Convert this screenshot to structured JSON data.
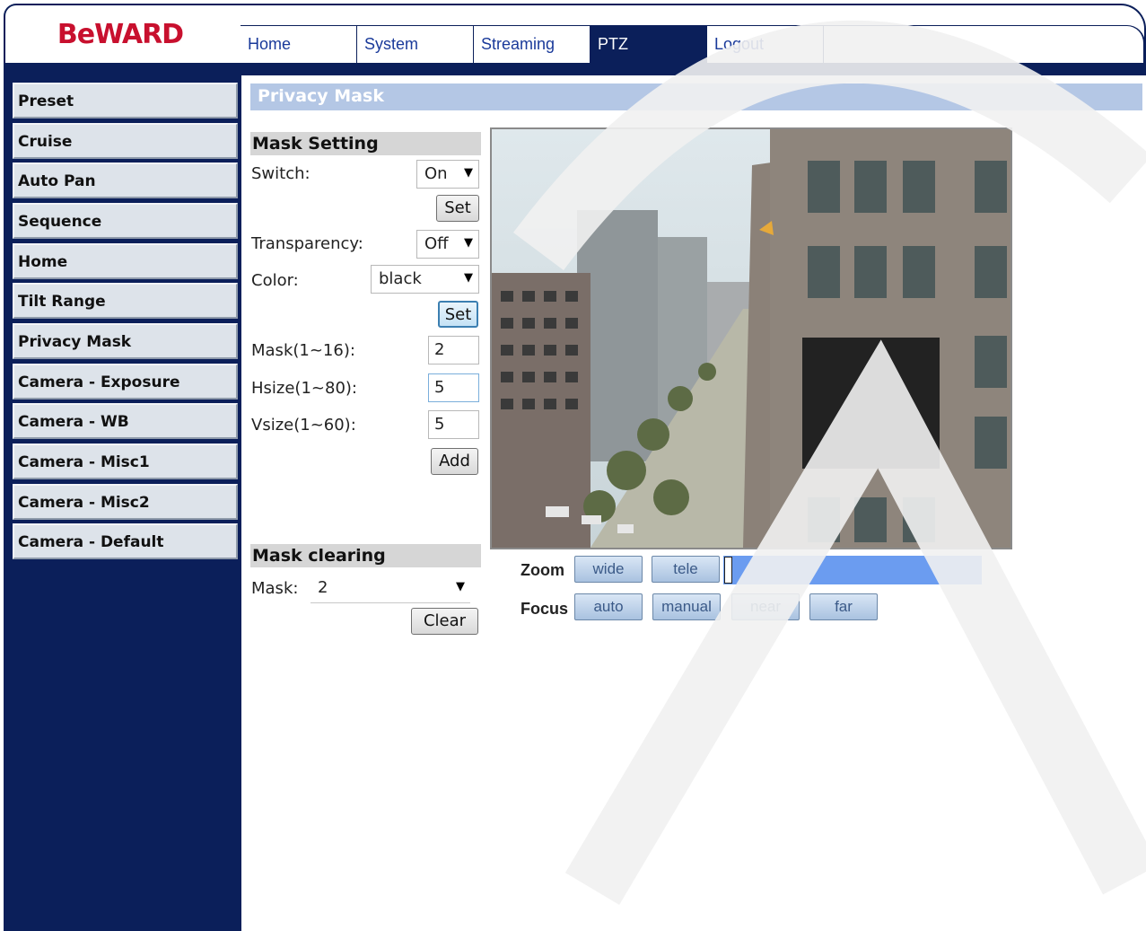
{
  "brand": {
    "logo_text": "BeWARD",
    "color": "#c8102e"
  },
  "nav": {
    "tabs": [
      {
        "label": "Home",
        "active": false
      },
      {
        "label": "System",
        "active": false
      },
      {
        "label": "Streaming",
        "active": false
      },
      {
        "label": "PTZ",
        "active": true
      },
      {
        "label": "Logout",
        "active": false
      }
    ]
  },
  "sidebar": {
    "items": [
      {
        "label": "Preset"
      },
      {
        "label": "Cruise"
      },
      {
        "label": "Auto Pan"
      },
      {
        "label": "Sequence"
      },
      {
        "label": "Home"
      },
      {
        "label": "Tilt Range"
      },
      {
        "label": "Privacy Mask"
      },
      {
        "label": "Camera - Exposure"
      },
      {
        "label": "Camera - WB"
      },
      {
        "label": "Camera - Misc1"
      },
      {
        "label": "Camera - Misc2"
      },
      {
        "label": "Camera - Default"
      }
    ]
  },
  "page": {
    "title": "Privacy Mask"
  },
  "mask_setting": {
    "heading": "Mask Setting",
    "switch_label": "Switch:",
    "switch_value": "On",
    "set_label": "Set",
    "transparency_label": "Transparency:",
    "transparency_value": "Off",
    "color_label": "Color:",
    "color_value": "black",
    "set2_label": "Set",
    "mask_label": "Mask(1~16):",
    "mask_value": "2",
    "hsize_label": "Hsize(1~80):",
    "hsize_value": "5",
    "vsize_label": "Vsize(1~60):",
    "vsize_value": "5",
    "add_label": "Add"
  },
  "mask_clearing": {
    "heading": "Mask clearing",
    "mask_label": "Mask:",
    "mask_value": "2",
    "clear_label": "Clear"
  },
  "ptz": {
    "zoom_label": "Zoom",
    "wide_label": "wide",
    "tele_label": "tele",
    "focus_label": "Focus",
    "auto_label": "auto",
    "manual_label": "manual",
    "near_label": "near",
    "far_label": "far",
    "zoom_level": 0
  },
  "colors": {
    "navy": "#0b1f5a",
    "title_bar": "#b4c7e5",
    "zoom_bar": "#6b9cf0"
  }
}
